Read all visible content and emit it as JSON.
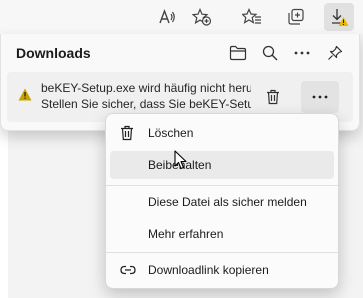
{
  "toolbar": {
    "icons": [
      "read-aloud-icon",
      "add-favorite-icon",
      "favorites-icon",
      "collections-icon",
      "downloads-warning-icon"
    ]
  },
  "downloads": {
    "title": "Downloads",
    "header_icons": [
      "folder-icon",
      "search-icon",
      "more-icon",
      "pin-icon"
    ],
    "item": {
      "status_icon": "warning-icon",
      "line1": "beKEY-Setup.exe wird häufig nicht heru",
      "line2": "Stellen Sie sicher, dass Sie beKEY-Setup"
    }
  },
  "context_menu": {
    "items": [
      {
        "label": "Löschen",
        "icon": "trash-icon"
      },
      {
        "label": "Beibehalten",
        "icon": ""
      },
      {
        "label": "Diese Datei als sicher melden",
        "icon": ""
      },
      {
        "label": "Mehr erfahren",
        "icon": ""
      },
      {
        "label": "Downloadlink kopieren",
        "icon": "link-icon"
      }
    ]
  },
  "colors": {
    "warning": "#c8a200",
    "accent_dark": "#1b1b1b"
  }
}
